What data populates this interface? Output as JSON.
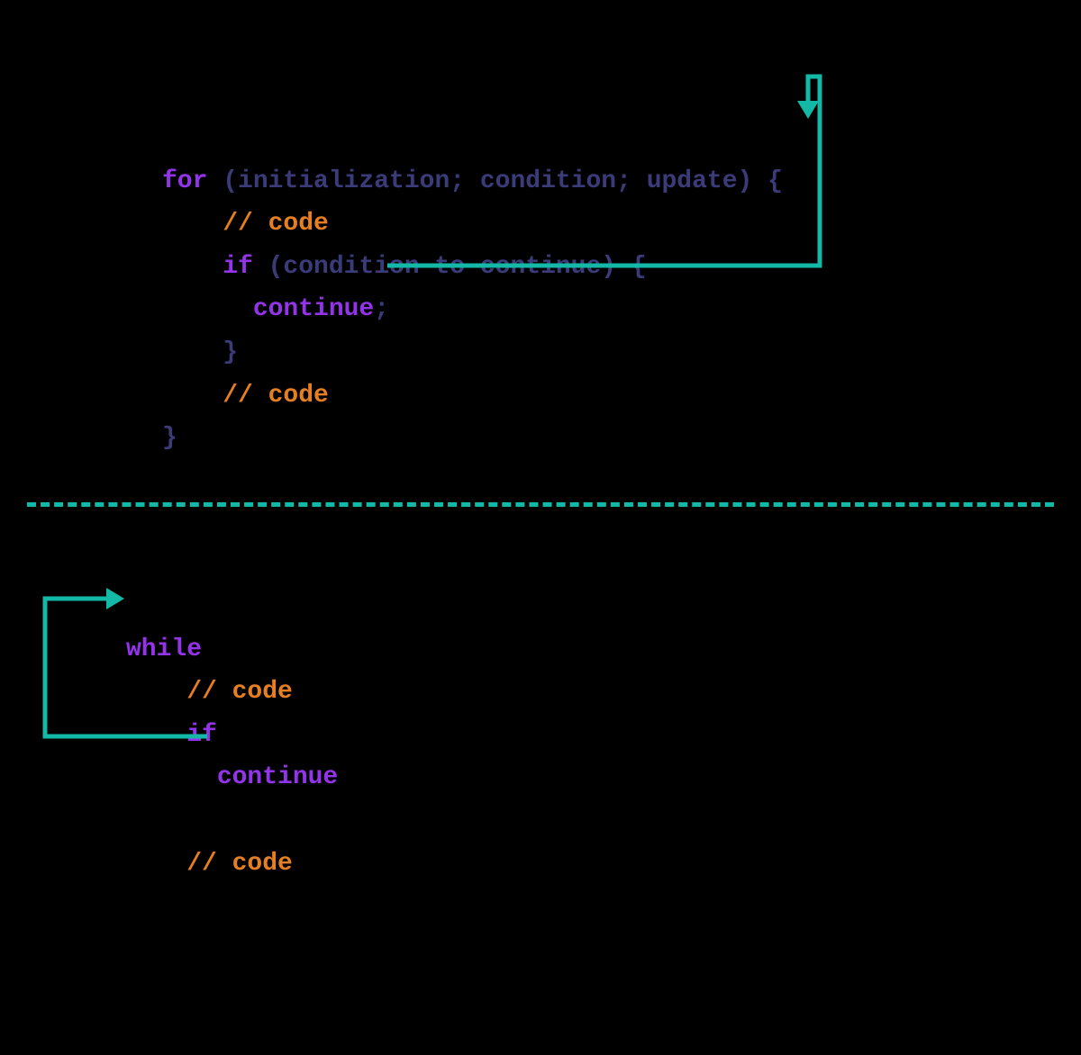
{
  "for_block": {
    "line1_for": "for",
    "line1_rest": " (initialization; condition; update) {",
    "line2_comment": "    // code",
    "line3_if": "    if",
    "line3_rest": " (condition to continue) {",
    "line4_continue": "      continue",
    "line4_semi": ";",
    "line5_close": "    }",
    "line6_comment": "    // code",
    "line7_close": "}"
  },
  "while_block": {
    "line1_while": "while",
    "line2_comment": "    // code",
    "line3_if": "    if",
    "line4_continue": "      continue",
    "line6_comment": "    // code"
  },
  "colors": {
    "keyword_purple": "#9333ea",
    "struct_navy": "#3b3b7a",
    "comment_orange": "#e67e22",
    "arrow_teal": "#14b8a6",
    "background": "#000000"
  }
}
